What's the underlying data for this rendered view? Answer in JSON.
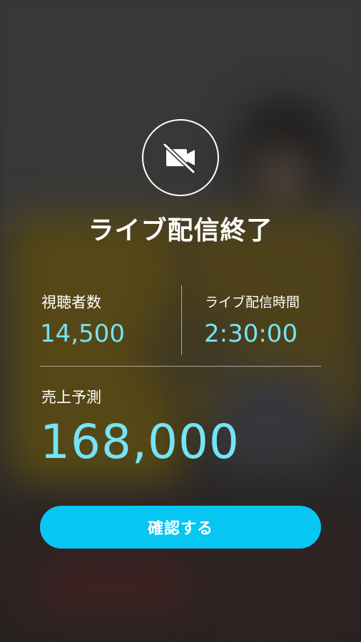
{
  "screen": {
    "title": "ライブ配信終了",
    "status_icon": "video-off-icon"
  },
  "stats": {
    "viewers": {
      "label": "視聴者数",
      "value": "14,500"
    },
    "duration": {
      "label": "ライブ配信時間",
      "value": "2:30:00"
    },
    "sales_forecast": {
      "label": "売上予測",
      "value": "168,000"
    }
  },
  "actions": {
    "confirm_label": "確認する"
  },
  "colors": {
    "accent_value": "#74e4f6",
    "button": "#08c6f2",
    "text": "#ffffff"
  }
}
